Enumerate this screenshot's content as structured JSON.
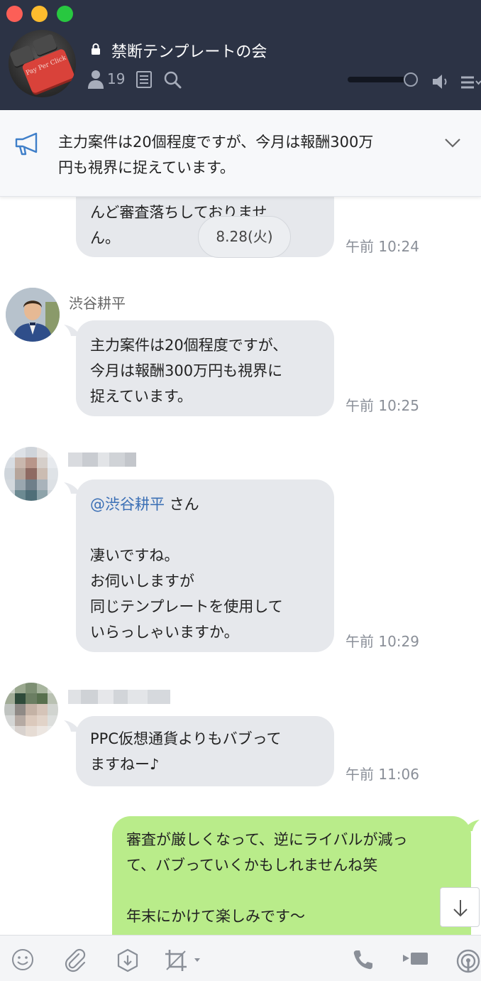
{
  "header": {
    "title": "禁断テンプレートの会",
    "member_count": "19",
    "avatar_key_text": "Pay Per Click"
  },
  "announcement": {
    "text_line1": "主力案件は20個程度ですが、今月は報酬300万",
    "text_line2": "円も視界に捉えています。"
  },
  "chat": {
    "date_separator": "8.28(火)",
    "messages": [
      {
        "sender": "",
        "lines": [
          "んど審査落ちしておりませ",
          "ん。"
        ],
        "time": "午前 10:24"
      },
      {
        "sender": "渋谷耕平",
        "lines": [
          "主力案件は20個程度ですが、",
          "今月は報酬300万円も視界に",
          "捉えています。"
        ],
        "time": "午前 10:25"
      },
      {
        "sender": "",
        "mention": "@渋谷耕平",
        "mention_suffix": " さん",
        "lines": [
          "凄いですね。",
          "お伺いしますが",
          "同じテンプレートを使用して",
          "いらっしゃいますか。"
        ],
        "time": "午前 10:29"
      },
      {
        "sender": "",
        "lines": [
          "PPC仮想通貨よりもバブって",
          "ますねー♪"
        ],
        "time": "午前 11:06"
      },
      {
        "sender": "me",
        "lines": [
          "審査が厳しくなって、逆にライバルが減っ",
          "て、バブっていくかもしれませんね笑",
          "",
          "年末にかけて楽しみです～"
        ]
      }
    ]
  },
  "colors": {
    "header_bg": "#2c3345",
    "incoming_bubble": "#e6e8ec",
    "outgoing_bubble": "#b9ec8a",
    "mention": "#3b6fb5",
    "icon_blue": "#3f7fc9"
  }
}
